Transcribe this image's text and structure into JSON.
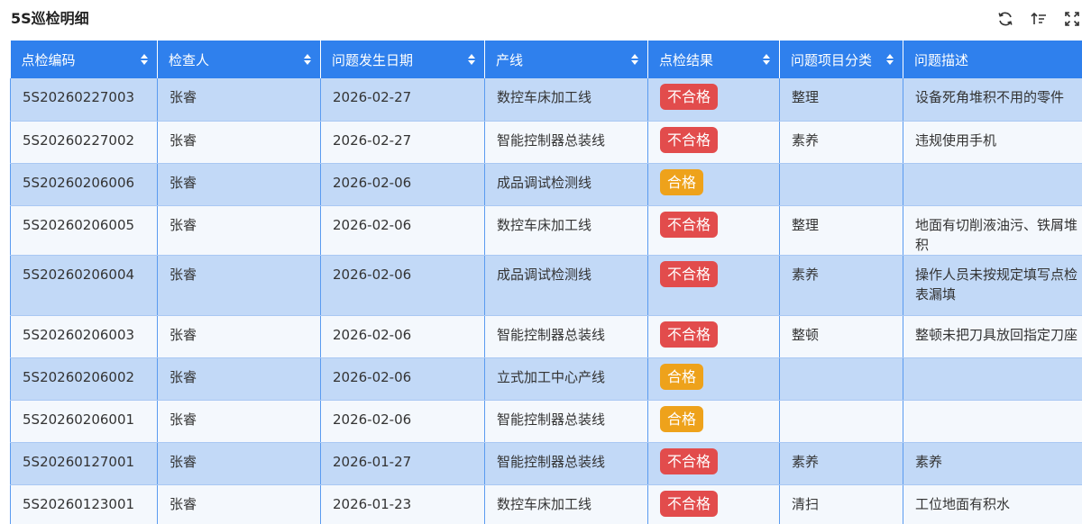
{
  "header": {
    "title": "5S巡检明细",
    "tools": [
      {
        "name": "refresh-icon"
      },
      {
        "name": "sort-ascending-icon"
      },
      {
        "name": "fullscreen-icon"
      }
    ]
  },
  "colors": {
    "header_bg": "#2f80ed",
    "row_odd": "#c2d9f7",
    "row_even": "#f4f8fd",
    "fail": "#e24c4c",
    "pass": "#eea21b"
  },
  "table": {
    "columns": [
      "点检编码",
      "检查人",
      "问题发生日期",
      "产线",
      "点检结果",
      "问题项目分类",
      "问题描述"
    ],
    "rows": [
      {
        "code": "5S20260227003",
        "inspector": "张睿",
        "date": "2026-02-27",
        "line": "数控车床加工线",
        "result": "不合格",
        "status": "fail",
        "category": "整理",
        "desc": "设备死角堆积不用的零件"
      },
      {
        "code": "5S20260227002",
        "inspector": "张睿",
        "date": "2026-02-27",
        "line": "智能控制器总装线",
        "result": "不合格",
        "status": "fail",
        "category": "素养",
        "desc": "违规使用手机"
      },
      {
        "code": "5S20260206006",
        "inspector": "张睿",
        "date": "2026-02-06",
        "line": "成品调试检测线",
        "result": "合格",
        "status": "pass",
        "category": "",
        "desc": ""
      },
      {
        "code": "5S20260206005",
        "inspector": "张睿",
        "date": "2026-02-06",
        "line": "数控车床加工线",
        "result": "不合格",
        "status": "fail",
        "category": "整理",
        "desc": "地面有切削液油污、铁屑堆积"
      },
      {
        "code": "5S20260206004",
        "inspector": "张睿",
        "date": "2026-02-06",
        "line": "成品调试检测线",
        "result": "不合格",
        "status": "fail",
        "category": "素养",
        "desc": "操作人员未按规定填写点检表漏填"
      },
      {
        "code": "5S20260206003",
        "inspector": "张睿",
        "date": "2026-02-06",
        "line": "智能控制器总装线",
        "result": "不合格",
        "status": "fail",
        "category": "整顿",
        "desc": "整顿未把刀具放回指定刀座"
      },
      {
        "code": "5S20260206002",
        "inspector": "张睿",
        "date": "2026-02-06",
        "line": "立式加工中心产线",
        "result": "合格",
        "status": "pass",
        "category": "",
        "desc": ""
      },
      {
        "code": "5S20260206001",
        "inspector": "张睿",
        "date": "2026-02-06",
        "line": "智能控制器总装线",
        "result": "合格",
        "status": "pass",
        "category": "",
        "desc": ""
      },
      {
        "code": "5S20260127001",
        "inspector": "张睿",
        "date": "2026-01-27",
        "line": "智能控制器总装线",
        "result": "不合格",
        "status": "fail",
        "category": "素养",
        "desc": "素养"
      },
      {
        "code": "5S20260123001",
        "inspector": "张睿",
        "date": "2026-01-23",
        "line": "数控车床加工线",
        "result": "不合格",
        "status": "fail",
        "category": "清扫",
        "desc": "工位地面有积水"
      }
    ]
  }
}
